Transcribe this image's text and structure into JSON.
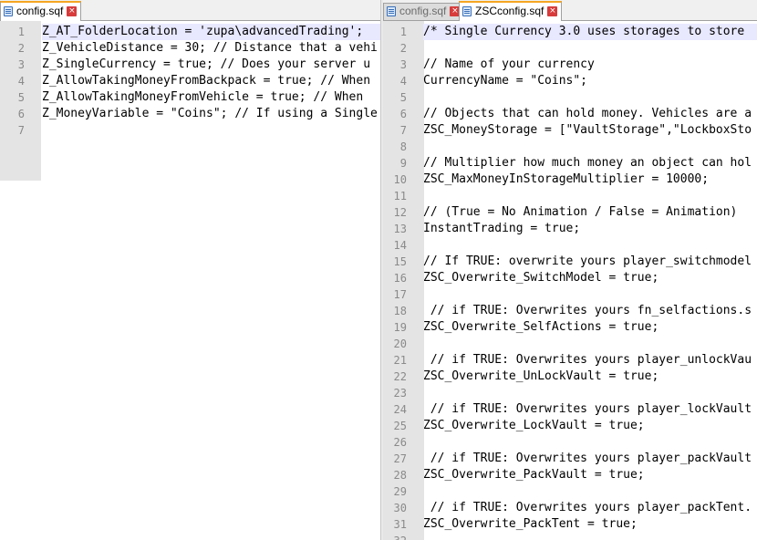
{
  "left": {
    "tab": {
      "label": "config.sqf",
      "close": "×"
    },
    "lines": [
      {
        "n": "1",
        "t": "Z_AT_FolderLocation = 'zupa\\advancedTrading';"
      },
      {
        "n": "2",
        "t": "Z_VehicleDistance = 30; // Distance that a vehi"
      },
      {
        "n": "3",
        "t": "Z_SingleCurrency = true; // Does your server u"
      },
      {
        "n": "4",
        "t": "Z_AllowTakingMoneyFromBackpack = true; // When"
      },
      {
        "n": "5",
        "t": "Z_AllowTakingMoneyFromVehicle = true; // When "
      },
      {
        "n": "6",
        "t": "Z_MoneyVariable = \"Coins\"; // If using a Single"
      },
      {
        "n": "7",
        "t": ""
      }
    ]
  },
  "right": {
    "tab_inactive": {
      "label": "config.sqf",
      "close": "×"
    },
    "tab_active": {
      "label": "ZSCconfig.sqf",
      "close": "×"
    },
    "lines": [
      {
        "n": "1",
        "t": "/* Single Currency 3.0 uses storages to store"
      },
      {
        "n": "2",
        "t": ""
      },
      {
        "n": "3",
        "t": "// Name of your currency"
      },
      {
        "n": "4",
        "t": "CurrencyName = \"Coins\";"
      },
      {
        "n": "5",
        "t": ""
      },
      {
        "n": "6",
        "t": "// Objects that can hold money. Vehicles are a"
      },
      {
        "n": "7",
        "t": "ZSC_MoneyStorage = [\"VaultStorage\",\"LockboxSto"
      },
      {
        "n": "8",
        "t": ""
      },
      {
        "n": "9",
        "t": "// Multiplier how much money an object can hol"
      },
      {
        "n": "10",
        "t": "ZSC_MaxMoneyInStorageMultiplier = 10000;"
      },
      {
        "n": "11",
        "t": ""
      },
      {
        "n": "12",
        "t": "// (True = No Animation / False = Animation)"
      },
      {
        "n": "13",
        "t": "InstantTrading = true;"
      },
      {
        "n": "14",
        "t": ""
      },
      {
        "n": "15",
        "t": "// If TRUE: overwrite yours player_switchmodel"
      },
      {
        "n": "16",
        "t": "ZSC_Overwrite_SwitchModel = true;"
      },
      {
        "n": "17",
        "t": ""
      },
      {
        "n": "18",
        "t": " // if TRUE: Overwrites yours fn_selfactions.s"
      },
      {
        "n": "19",
        "t": "ZSC_Overwrite_SelfActions = true;"
      },
      {
        "n": "20",
        "t": ""
      },
      {
        "n": "21",
        "t": " // if TRUE: Overwrites yours player_unlockVau"
      },
      {
        "n": "22",
        "t": "ZSC_Overwrite_UnLockVault = true;"
      },
      {
        "n": "23",
        "t": ""
      },
      {
        "n": "24",
        "t": " // if TRUE: Overwrites yours player_lockVault"
      },
      {
        "n": "25",
        "t": "ZSC_Overwrite_LockVault = true;"
      },
      {
        "n": "26",
        "t": ""
      },
      {
        "n": "27",
        "t": " // if TRUE: Overwrites yours player_packVault"
      },
      {
        "n": "28",
        "t": "ZSC_Overwrite_PackVault = true;"
      },
      {
        "n": "29",
        "t": ""
      },
      {
        "n": "30",
        "t": " // if TRUE: Overwrites yours player_packTent."
      },
      {
        "n": "31",
        "t": "ZSC_Overwrite_PackTent = true;"
      },
      {
        "n": "32",
        "t": ""
      }
    ]
  },
  "colors": {
    "active_tab_accent": "#f5a623",
    "close_button": "#d73b3b",
    "current_line": "#e8e8ff",
    "gutter": "#e4e4e4"
  }
}
